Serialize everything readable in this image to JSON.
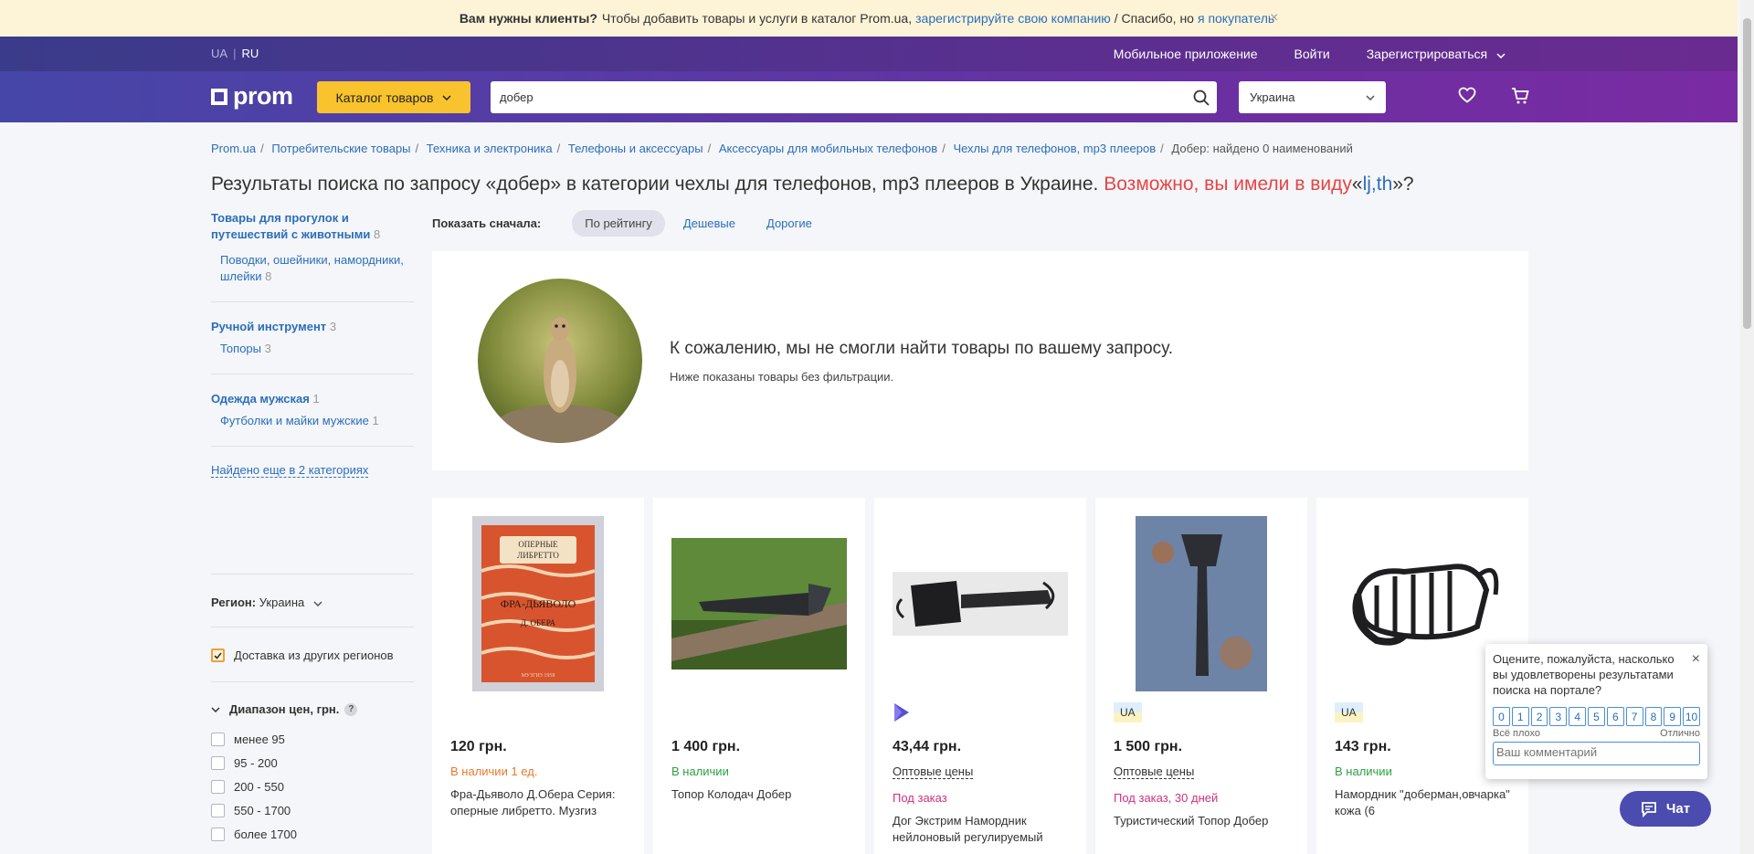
{
  "banner": {
    "bold": "Вам нужны клиенты?",
    "text1": "Чтобы добавить товары и услуги в каталог Prom.ua,",
    "link1": "зарегистрируйте свою компанию",
    "text2": "/ Спасибо, но",
    "link2": "я покупатель",
    "close": "×"
  },
  "topbar": {
    "lang_ua": "UA",
    "lang_sep": "|",
    "lang_ru": "RU",
    "mobile_app": "Мобильное приложение",
    "login": "Войти",
    "register": "Зарегистрироваться"
  },
  "header": {
    "logo": "prom",
    "catalog": "Каталог товаров",
    "search_value": "добер",
    "region": "Украина"
  },
  "breadcrumb": [
    "Prom.ua",
    "Потребительские товары",
    "Техника и электроника",
    "Телефоны и аксессуары",
    "Аксессуары для мобильных телефонов",
    "Чехлы для телефонов, mp3 плееров"
  ],
  "breadcrumb_last": "Добер: найдено 0 наименований",
  "page_title": {
    "main": "Результаты поиска по запросу «добер» в категории чехлы для телефонов, mp3 плееров в Украине.",
    "maybe": "Возможно, вы имели в виду",
    "open_quote": "«",
    "suggest": "lj,th",
    "close_quote": "»?"
  },
  "sidebar": {
    "cats": [
      {
        "title": "Товары для прогулок и путешествий с животными",
        "count": "8",
        "sub": "Поводки, ошейники, намордники, шлейки",
        "sub_count": "8"
      },
      {
        "title": "Ручной инструмент",
        "count": "3",
        "sub": "Топоры",
        "sub_count": "3"
      },
      {
        "title": "Одежда мужская",
        "count": "1",
        "sub": "Футболки и майки мужские",
        "sub_count": "1"
      }
    ],
    "more": "Найдено еще в 2 категориях",
    "region_label": "Регион:",
    "region_value": "Украина",
    "delivery": "Доставка из других регионов",
    "price_head": "Диапазон цен, грн.",
    "price_q": "?",
    "prices": [
      "менее 95",
      "95 - 200",
      "200 - 550",
      "550 - 1700",
      "более 1700"
    ]
  },
  "sort": {
    "label": "Показать сначала:",
    "rating": "По рейтингу",
    "cheap": "Дешевые",
    "expensive": "Дорогие"
  },
  "empty": {
    "message": "К сожалению, мы не смогли найти товары по вашему запросу.",
    "sub": "Ниже показаны товары без фильтрации."
  },
  "products": [
    {
      "price": "120 грн.",
      "avail": "В наличии 1 ед.",
      "title": "Фра-Дьяволо Д.Обера Серия: оперные либретто. Музгиз"
    },
    {
      "price": "1 400 грн.",
      "avail": "В наличии",
      "title": "Топор Колодач Добер"
    },
    {
      "price": "43,44 грн.",
      "wholesale": "Оптовые цены",
      "order": "Под заказ",
      "title": "Дог Экстрим Намордник нейлоновый регулируемый"
    },
    {
      "badge": "UA",
      "price": "1 500 грн.",
      "wholesale": "Оптовые цены",
      "order": "Под заказ, 30 дней",
      "title": "Туристический Топор Добер"
    },
    {
      "badge": "UA",
      "price": "143 грн.",
      "avail": "В наличии",
      "title": "Намордник \"доберман,овчарка\" кожа (6"
    }
  ],
  "book": {
    "line1": "ОПЕРНЫЕ",
    "line2": "ЛИБРЕТТО",
    "title": "ФРА-ДЬЯВОЛО",
    "author": "Д. ОБЕРА",
    "footer": "МУЗГИЗ 1958"
  },
  "rating": {
    "question": "Оцените, пожалуйста, насколько вы удовлетворены результатами поиска на портале?",
    "nums": [
      "0",
      "1",
      "2",
      "3",
      "4",
      "5",
      "6",
      "7",
      "8",
      "9",
      "10"
    ],
    "bad": "Всё плохо",
    "good": "Отлично",
    "placeholder": "Ваш комментарий"
  },
  "chat": "Чат",
  "colors": {
    "accent": "#f8c32d",
    "brand_purple": "#6a2fa0",
    "link": "#2a6ebb",
    "warning": "#e64545"
  }
}
